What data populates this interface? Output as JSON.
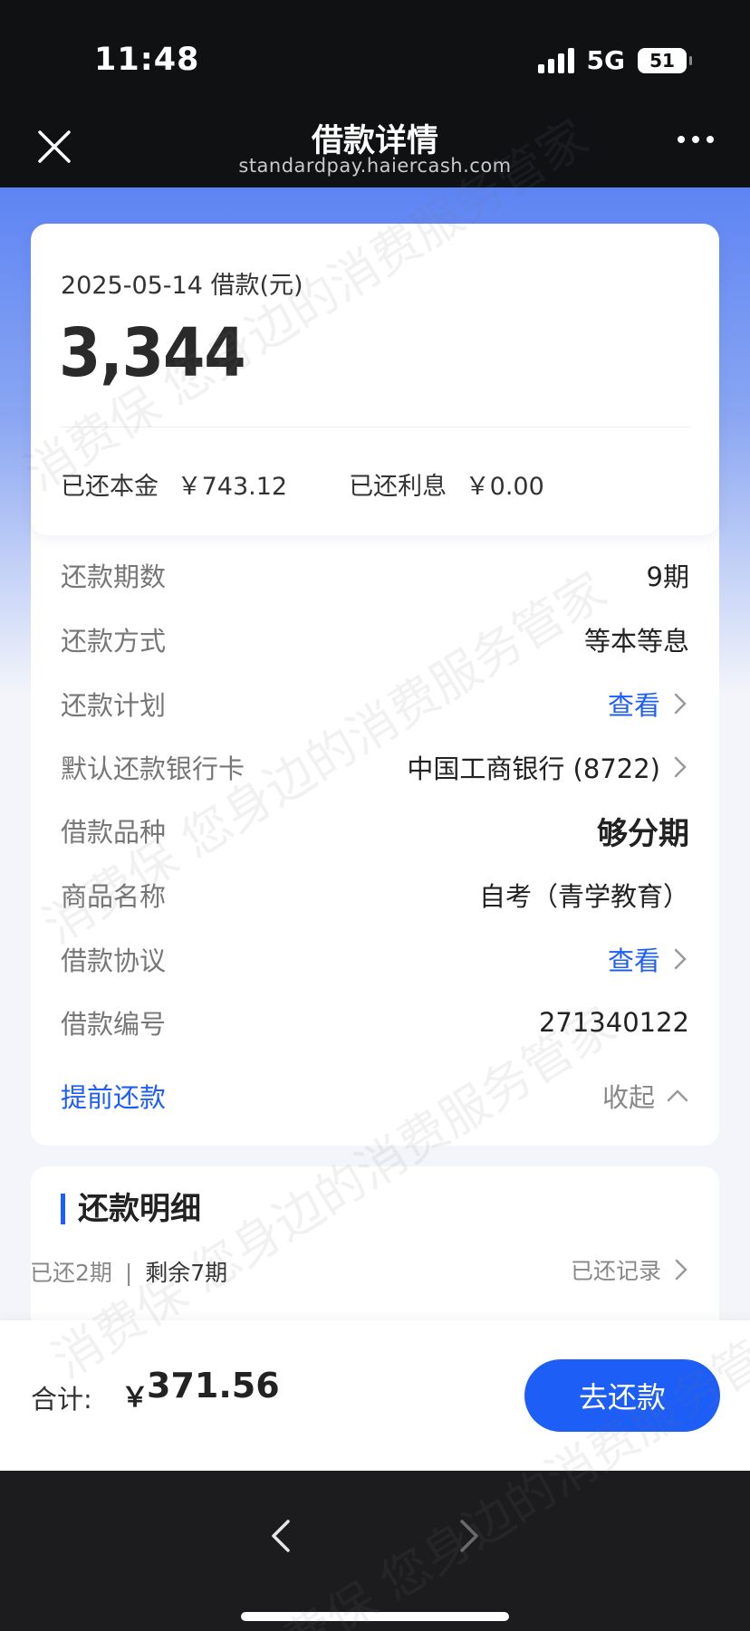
{
  "status_bar": {
    "time": "11:48",
    "network": "5G",
    "battery": "51"
  },
  "nav": {
    "title": "借款详情",
    "url": "standardpay.haiercash.com",
    "close_icon": "close-icon",
    "more_icon": "more-dots-icon"
  },
  "summary": {
    "date_label": "2025-05-14 借款(元)",
    "amount": "3,344",
    "paid_principal_label": "已还本金",
    "paid_principal_value": "￥743.12",
    "paid_interest_label": "已还利息",
    "paid_interest_value": "￥0.00"
  },
  "details": [
    {
      "label": "还款期数",
      "value": "9期"
    },
    {
      "label": "还款方式",
      "value": "等本等息"
    },
    {
      "label": "还款计划",
      "value": "查看"
    },
    {
      "label": "默认还款银行卡",
      "value": "中国工商银行 (8722)"
    },
    {
      "label": "借款品种",
      "value": "够分期"
    },
    {
      "label": "商品名称",
      "value": "自考（青学教育）"
    },
    {
      "label": "借款协议",
      "value": "查看"
    },
    {
      "label": "借款编号",
      "value": "271340122"
    }
  ],
  "actions": {
    "early_repay": "提前还款",
    "collapse": "收起"
  },
  "repay_detail": {
    "title": "还款明细",
    "paid_periods": "已还2期",
    "separator": "|",
    "remaining": "剩余7期",
    "history_link": "已还记录"
  },
  "footer": {
    "total_label": "合计:",
    "currency": "￥",
    "total_value": "371.56",
    "pay_button": "去还款"
  },
  "watermark": "消费保 您身边的消费服务管家",
  "colors": {
    "accent": "#1d5ef6",
    "header_bg": "#101113",
    "gradient_top": "#5d84f3"
  }
}
